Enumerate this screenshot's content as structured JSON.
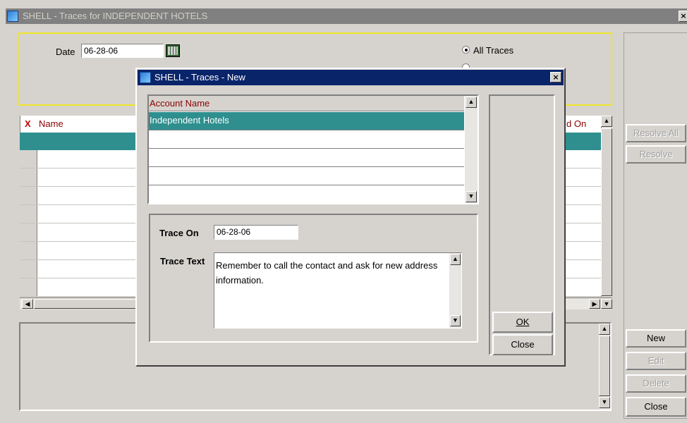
{
  "parent": {
    "title": "SHELL - Traces for INDEPENDENT HOTELS",
    "date_label": "Date",
    "date_value": "06-28-06",
    "radio_all_traces": "All Traces",
    "grid": {
      "delete_col_marker": "X",
      "col_name": "Name",
      "col_resolved_on": "d On"
    },
    "buttons": {
      "resolve_all": "Resolve All",
      "resolve": "Resolve",
      "new": "New",
      "edit": "Edit",
      "delete": "Delete",
      "close": "Close"
    }
  },
  "dialog": {
    "title": "SHELL - Traces - New",
    "account_header": "Account Name",
    "accounts": [
      "Independent Hotels",
      "",
      "",
      "",
      ""
    ],
    "trace_on_label": "Trace On",
    "trace_on_value": "06-28-06",
    "trace_text_label": "Trace Text",
    "trace_text_value": "Remember to call the contact and ask for new address information.",
    "ok_label": "OK",
    "close_label": "Close"
  },
  "colors": {
    "selected_row": "#2f8f8f",
    "highlight_border": "#f0e62a",
    "header_text": "#8b0000"
  }
}
